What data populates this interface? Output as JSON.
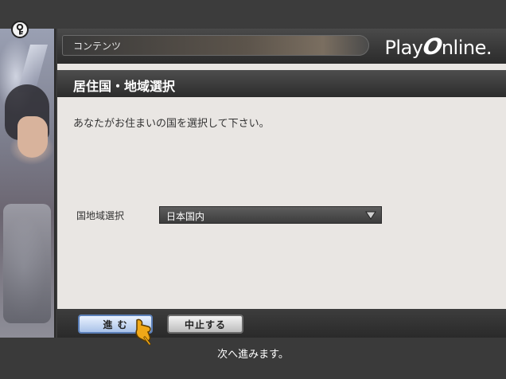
{
  "header": {
    "breadcrumb": "コンテンツ",
    "logo_text_left": "Play",
    "logo_text_o": "O",
    "logo_text_right": "nline",
    "logo_suffix": "."
  },
  "page": {
    "title": "居住国・地域選択",
    "instruction": "あなたがお住まいの国を選択して下さい。"
  },
  "form": {
    "region_label": "国地域選択",
    "region_value": "日本国内"
  },
  "buttons": {
    "next_label": "進 む",
    "cancel_label": "中止する"
  },
  "status": {
    "message": "次へ進みます。"
  },
  "icons": {
    "help": "key-help-icon",
    "dropdown": "triangle-down-icon",
    "cursor": "hand-pointer-icon"
  },
  "colors": {
    "window_bg": "#e9e6e3",
    "bar_dark": "#2b2b2b",
    "next_button_border": "#5b7fb8"
  }
}
